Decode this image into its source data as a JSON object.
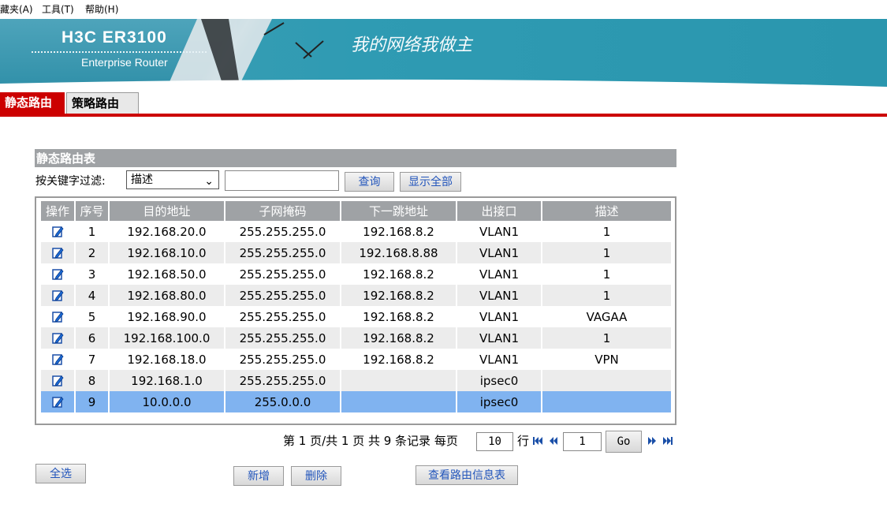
{
  "menu": {
    "favorites": "藏夹(A)",
    "tools": "工具(T)",
    "help": "帮助(H)"
  },
  "banner": {
    "brand": "H3C",
    "model": "ER3100",
    "subtitle": "Enterprise Router",
    "slogan": "我的网络我做主"
  },
  "tabs": {
    "static_route": "静态路由",
    "policy_route": "策略路由"
  },
  "panel": {
    "title": "静态路由表",
    "filter_label": "按关键字过滤:",
    "filter_select": "描述",
    "filter_value": "",
    "query_button": "查询",
    "show_all_button": "显示全部"
  },
  "table": {
    "headers": [
      "操作",
      "序号",
      "目的地址",
      "子网掩码",
      "下一跳地址",
      "出接口",
      "描述"
    ],
    "rows": [
      {
        "no": "1",
        "dest": "192.168.20.0",
        "mask": "255.255.255.0",
        "next_hop": "192.168.8.2",
        "iface": "VLAN1",
        "desc": "1"
      },
      {
        "no": "2",
        "dest": "192.168.10.0",
        "mask": "255.255.255.0",
        "next_hop": "192.168.8.88",
        "iface": "VLAN1",
        "desc": "1"
      },
      {
        "no": "3",
        "dest": "192.168.50.0",
        "mask": "255.255.255.0",
        "next_hop": "192.168.8.2",
        "iface": "VLAN1",
        "desc": "1"
      },
      {
        "no": "4",
        "dest": "192.168.80.0",
        "mask": "255.255.255.0",
        "next_hop": "192.168.8.2",
        "iface": "VLAN1",
        "desc": "1"
      },
      {
        "no": "5",
        "dest": "192.168.90.0",
        "mask": "255.255.255.0",
        "next_hop": "192.168.8.2",
        "iface": "VLAN1",
        "desc": "VAGAA"
      },
      {
        "no": "6",
        "dest": "192.168.100.0",
        "mask": "255.255.255.0",
        "next_hop": "192.168.8.2",
        "iface": "VLAN1",
        "desc": "1"
      },
      {
        "no": "7",
        "dest": "192.168.18.0",
        "mask": "255.255.255.0",
        "next_hop": "192.168.8.2",
        "iface": "VLAN1",
        "desc": "VPN"
      },
      {
        "no": "8",
        "dest": "192.168.1.0",
        "mask": "255.255.255.0",
        "next_hop": "",
        "iface": "ipsec0",
        "desc": ""
      },
      {
        "no": "9",
        "dest": "10.0.0.0",
        "mask": "255.0.0.0",
        "next_hop": "",
        "iface": "ipsec0",
        "desc": ""
      }
    ],
    "selected_row": 9
  },
  "pager": {
    "summary": "第 1 页/共 1 页 共 9 条记录 每页",
    "per_page": "10",
    "rows_unit": "行",
    "page": "1",
    "go_button": "Go"
  },
  "actions": {
    "select_all": "全选",
    "add": "新增",
    "delete": "删除",
    "view_table": "查看路由信息表"
  },
  "colors": {
    "accent_red": "#cc0000",
    "header_gray": "#9fa2a5",
    "selected_row": "#80b3f0",
    "banner_teal": "#2f9bb3"
  }
}
